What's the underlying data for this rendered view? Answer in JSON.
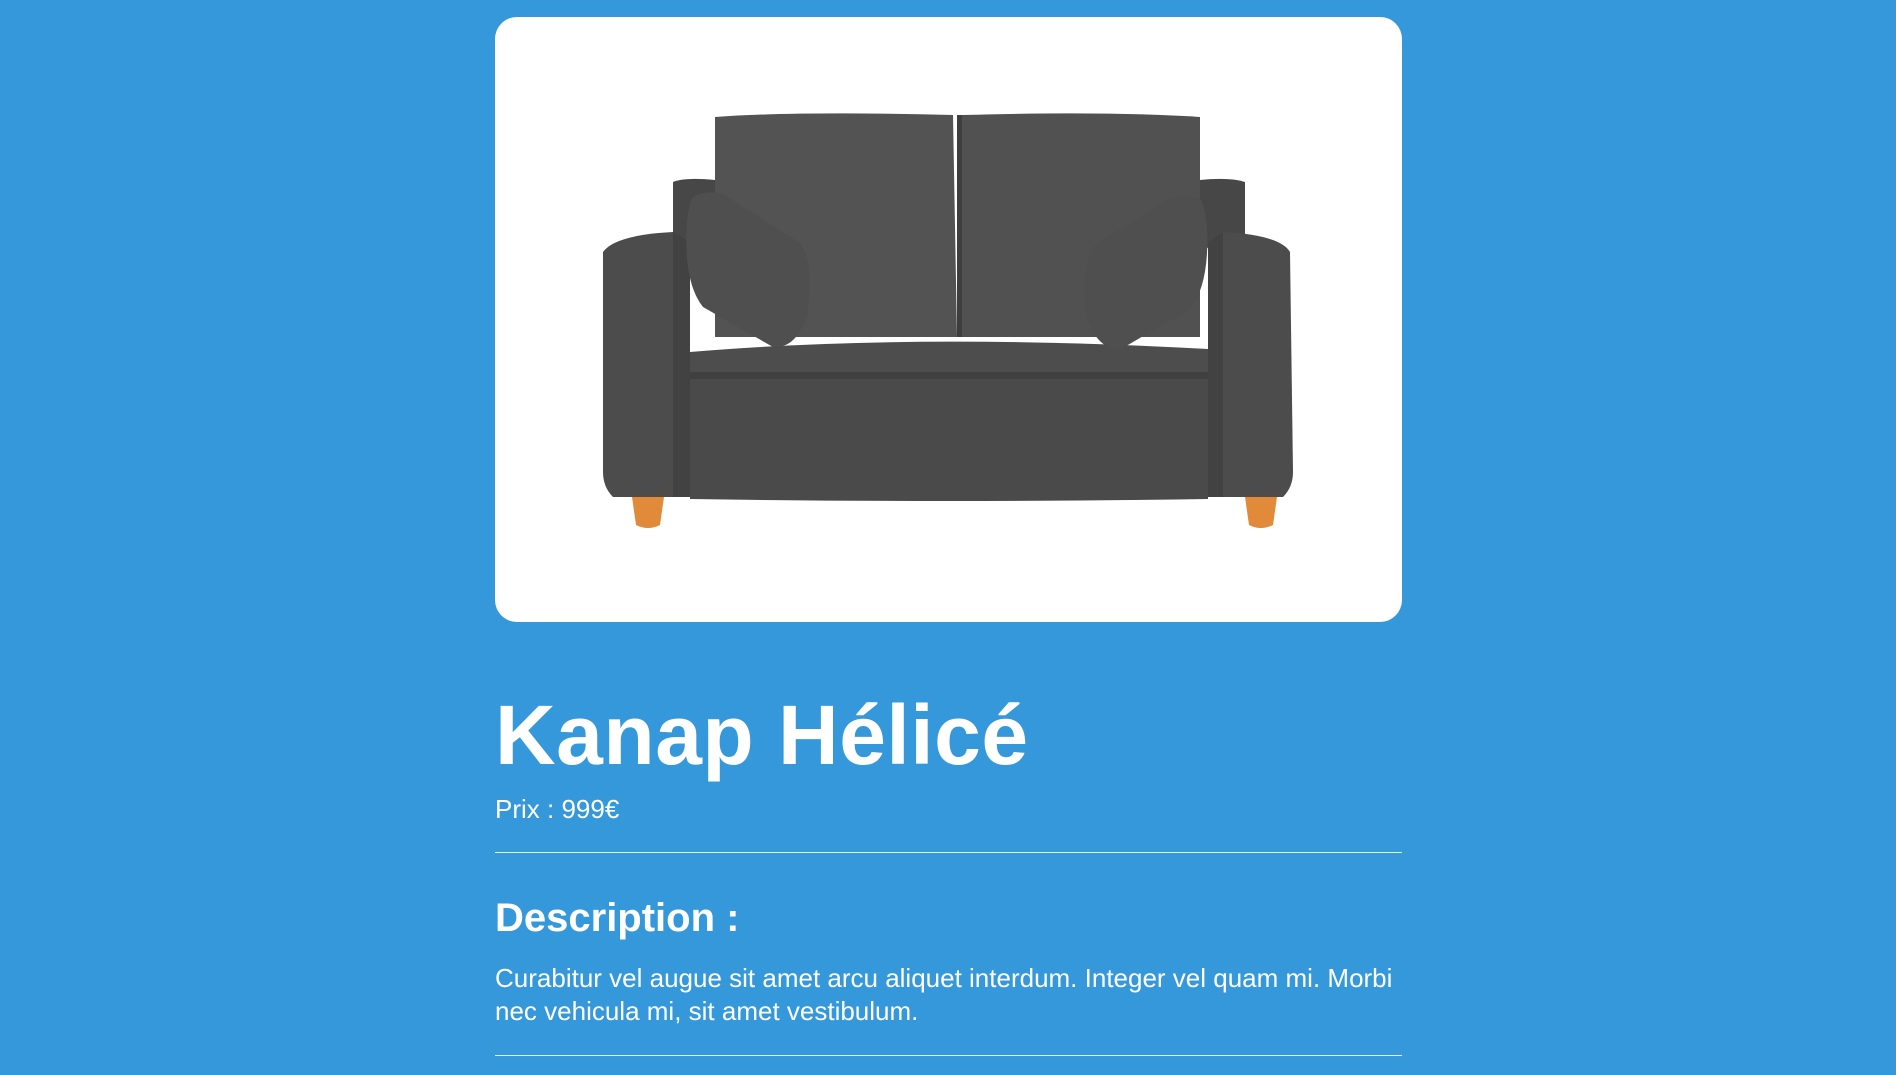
{
  "product": {
    "image_alt": "sofa-image",
    "title": "Kanap Hélicé",
    "price_label": "Prix : ",
    "price_value": "999",
    "currency": "€",
    "description_heading": "Description :",
    "description_text": "Curabitur vel augue sit amet arcu aliquet interdum. Integer vel quam mi. Morbi nec vehicula mi, sit amet vestibulum."
  },
  "colors": {
    "background": "#3498db",
    "card": "#ffffff",
    "sofa": "#4a4a4a",
    "legs": "#e08a3a"
  }
}
